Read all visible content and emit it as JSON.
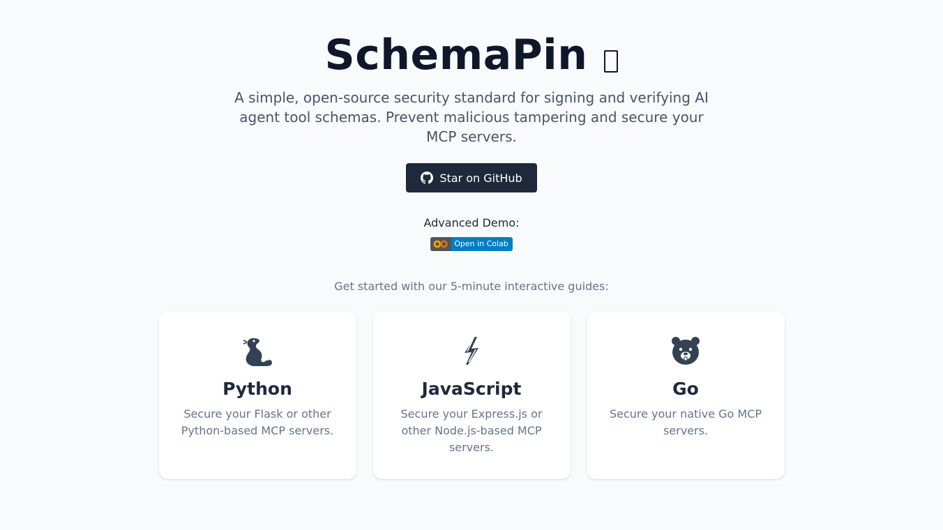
{
  "hero": {
    "title": "SchemaPin",
    "title_emoji": "missing-glyph-icon",
    "subtitle": "A simple, open-source security standard for signing and verifying AI agent tool schemas. Prevent malicious tampering and secure your MCP servers."
  },
  "github_button": {
    "label": "Star on GitHub",
    "icon": "github-icon"
  },
  "demo": {
    "label": "Advanced Demo:",
    "badge_text": "Open in Colab",
    "badge_icon": "colab-logo-icon"
  },
  "guides": {
    "intro": "Get started with our 5-minute interactive guides:",
    "cards": [
      {
        "icon": "snake-icon",
        "title": "Python",
        "description": "Secure your Flask or other Python-based MCP servers."
      },
      {
        "icon": "lightning-icon",
        "title": "JavaScript",
        "description": "Secure your Express.js or other Node.js-based MCP servers."
      },
      {
        "icon": "gopher-icon",
        "title": "Go",
        "description": "Secure your native Go MCP servers."
      }
    ]
  },
  "colors": {
    "background": "#f8fafc",
    "title": "#0f172a",
    "button": "#1e293b",
    "muted_text": "#64748b",
    "badge_blue": "#007ec6"
  }
}
